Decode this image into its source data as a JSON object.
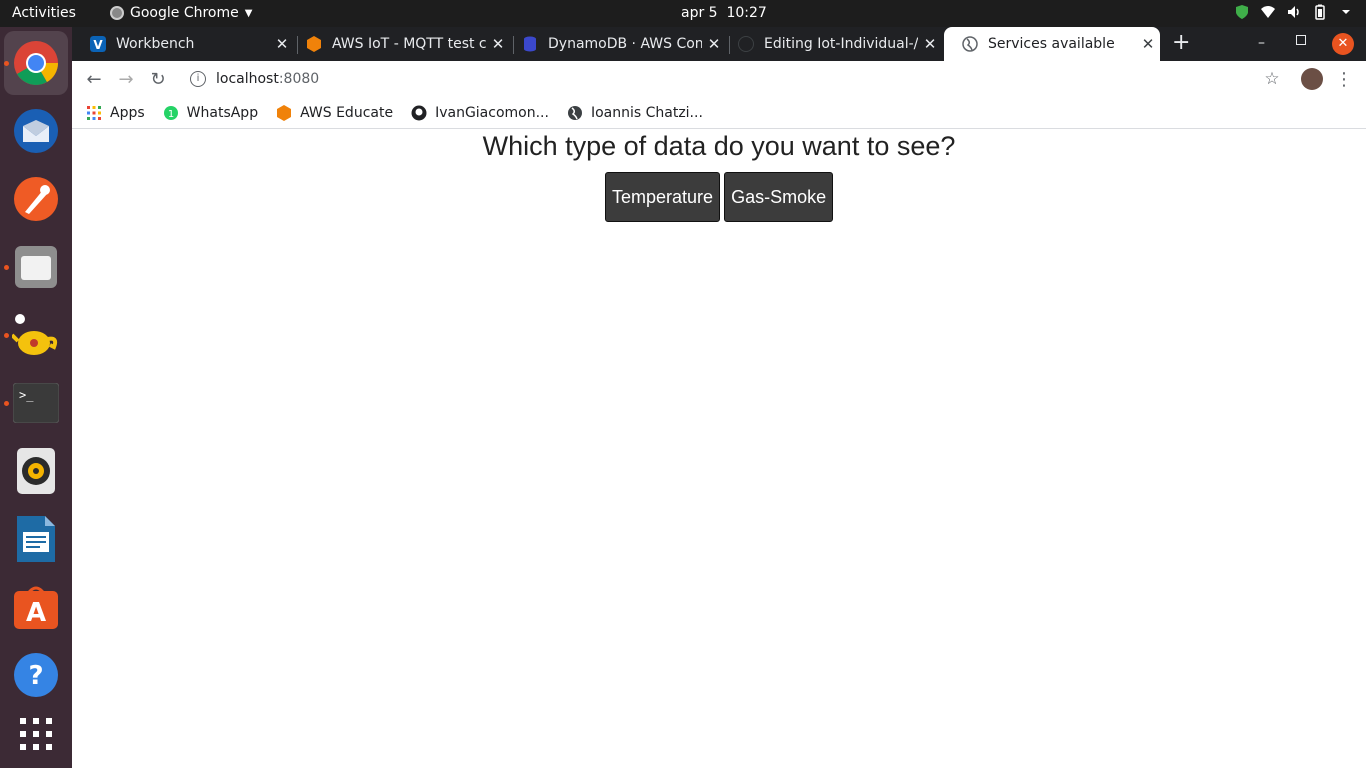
{
  "topbar": {
    "activities": "Activities",
    "app_name": "Google Chrome",
    "clock": "apr 5  10:27"
  },
  "dock": {
    "items": [
      "chrome-icon",
      "thunderbird-icon",
      "postman-icon",
      "files-icon",
      "jupyter-icon",
      "terminal-icon",
      "rhythmbox-icon",
      "writer-icon",
      "software-icon",
      "help-icon",
      "apps-grid-icon"
    ]
  },
  "tabs": [
    {
      "title": "Workbench",
      "favicon_color": "#0b63b6"
    },
    {
      "title": "AWS IoT - MQTT test cl",
      "favicon_color": "#f0820a"
    },
    {
      "title": "DynamoDB · AWS Con",
      "favicon_color": "#3b48cc"
    },
    {
      "title": "Editing Iot-Individual-/",
      "favicon_color": "#202124"
    },
    {
      "title": "Services available",
      "favicon_color": "#5f6368"
    }
  ],
  "toolbar": {
    "url_host": "localhost",
    "url_port": ":8080"
  },
  "bookmarks": [
    {
      "label": "Apps",
      "icon": "apps-icon"
    },
    {
      "label": "WhatsApp",
      "icon": "whatsapp-icon"
    },
    {
      "label": "AWS Educate",
      "icon": "aws-icon"
    },
    {
      "label": "IvanGiacomon...",
      "icon": "github-icon"
    },
    {
      "label": "Ioannis Chatzi...",
      "icon": "globe-icon"
    }
  ],
  "page": {
    "question": "Which type of data do you want to see?",
    "buttons": [
      "Temperature",
      "Gas-Smoke"
    ]
  }
}
